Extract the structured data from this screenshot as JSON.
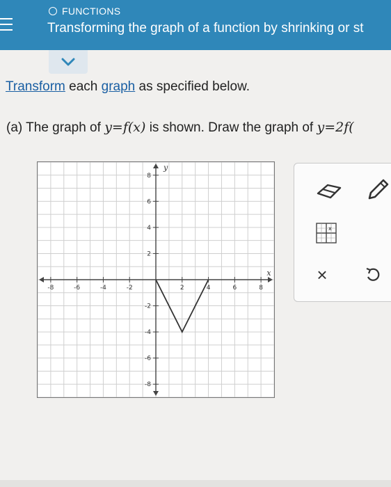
{
  "header": {
    "topic": "FUNCTIONS",
    "title": "Transforming the graph of a function by shrinking or st"
  },
  "instructions": {
    "link1": "Transform",
    "mid1": " each ",
    "link2": "graph",
    "tail": " as specified below."
  },
  "question": {
    "part": "(a) The graph of ",
    "eq1": "y=f(x)",
    "mid": " is shown. Draw the graph of ",
    "eq2": "y=2f("
  },
  "graph": {
    "x_axis_label": "x",
    "y_axis_label": "y",
    "x_tick_labels": [
      "-8",
      "-6",
      "-4",
      "-2",
      "2",
      "4",
      "6",
      "8"
    ],
    "y_tick_labels": [
      "8",
      "6",
      "4",
      "2",
      "-2",
      "-4",
      "-6",
      "-8"
    ],
    "range": [
      -9,
      9
    ],
    "function_points": [
      [
        0,
        0
      ],
      [
        2,
        -4
      ],
      [
        4,
        0
      ]
    ]
  },
  "tools": {
    "eraser": "eraser-icon",
    "pencil": "pencil-icon",
    "graph": "graph-grid-icon",
    "clear": "×",
    "undo": "undo-icon"
  },
  "colors": {
    "header_bg": "#2f87b9",
    "link": "#1a5fa3",
    "plot_line": "#333333"
  }
}
